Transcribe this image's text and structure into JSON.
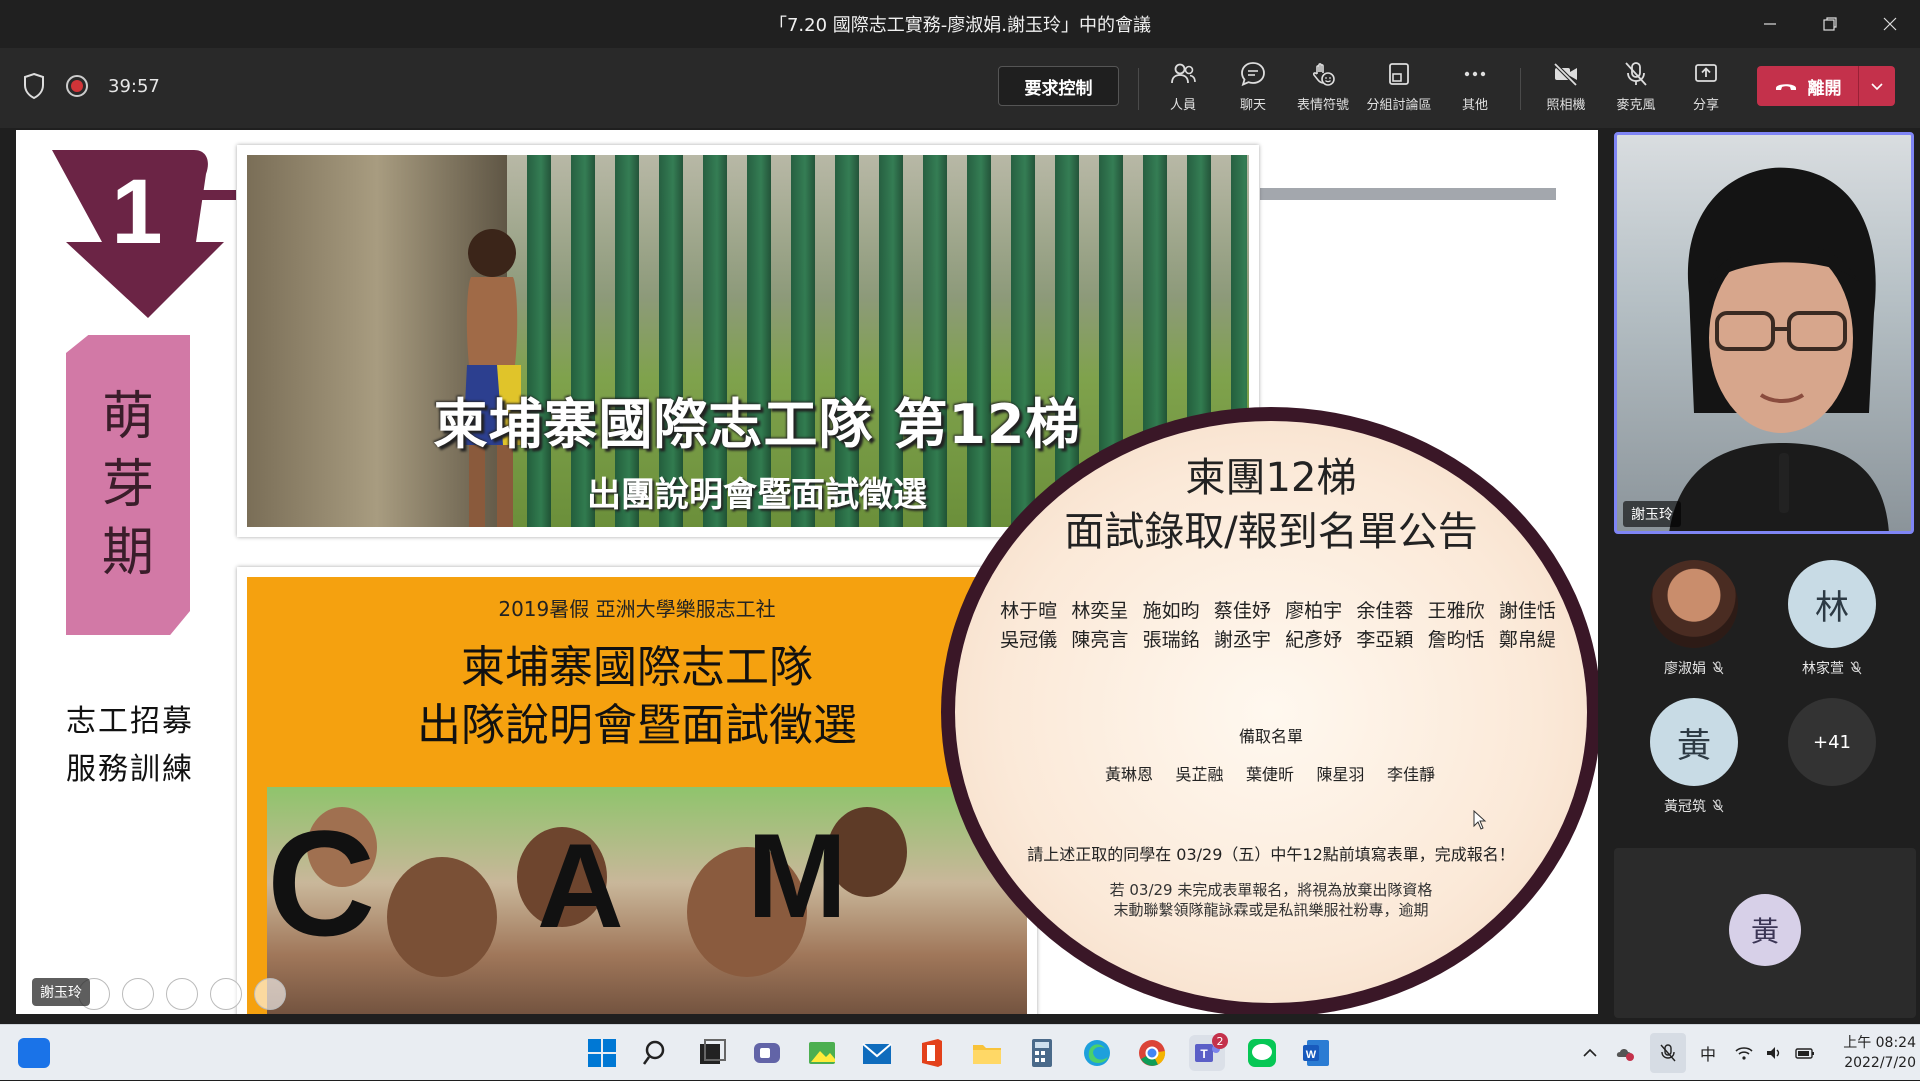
{
  "window": {
    "title": "「7.20 國際志工實務-廖淑娟.謝玉玲」中的會議"
  },
  "meeting": {
    "timer": "39:57",
    "request_control": "要求控制",
    "tools": [
      {
        "id": "people",
        "label": "人員",
        "icon": "people-icon"
      },
      {
        "id": "chat",
        "label": "聊天",
        "icon": "chat-icon"
      },
      {
        "id": "reactions",
        "label": "表情符號",
        "icon": "reactions-icon"
      },
      {
        "id": "breakout",
        "label": "分組討論區",
        "icon": "breakout-rooms-icon"
      },
      {
        "id": "more",
        "label": "其他",
        "icon": "more-icon"
      },
      {
        "id": "camera",
        "label": "照相機",
        "icon": "camera-off-icon"
      },
      {
        "id": "mic",
        "label": "麥克風",
        "icon": "mic-off-icon"
      },
      {
        "id": "share",
        "label": "分享",
        "icon": "share-icon"
      }
    ],
    "leave": "離開",
    "leave_color": "#c4314b"
  },
  "slide": {
    "step_number": "1",
    "stage_chars": [
      "萌",
      "芽",
      "期"
    ],
    "left_lines": [
      "志工招募",
      "服務訓練"
    ],
    "photo1_title": "柬埔寨國際志工隊 第12梯",
    "photo1_subtitle": "出團說明會暨面試徵選",
    "poster_org": "2019暑假 亞洲大學樂服志工社",
    "poster_title_1": "柬埔寨國際志工隊",
    "poster_title_2": "出隊說明會暨面試徵選",
    "poster_letters": [
      "C",
      "A",
      "M"
    ],
    "announcement": {
      "title_1": "柬團12梯",
      "title_2": "面試錄取/報到名單公告",
      "accepted": [
        "林于暄",
        "林奕呈",
        "施如昀",
        "蔡佳妤",
        "廖柏宇",
        "余佳蓉",
        "王雅欣",
        "謝佳恬",
        "吳冠儀",
        "陳亮言",
        "張瑞銘",
        "謝丞宇",
        "紀彥妤",
        "李亞穎",
        "詹昀恬",
        "鄭帛緹"
      ],
      "alternate_label": "備取名單",
      "alternates": [
        "黃琳恩",
        "吳芷融",
        "葉倢昕",
        "陳星羽",
        "李佳靜"
      ],
      "notice_1": "請上述正取的同學在 03/29（五）中午12點前填寫表單，完成報名！",
      "notice_2": "若 03/29 未完成表單報名，將視為放棄出隊資格",
      "notice_3": "末動聯繫領隊龍詠霖或是私訊樂服社粉專，逾期"
    },
    "presenter_label": "謝玉玲"
  },
  "side": {
    "active_speaker": "謝玉玲",
    "active_border_color": "#7f85f5",
    "participants": [
      {
        "name": "廖淑娟",
        "avatar": "photo",
        "initial": "",
        "muted": true
      },
      {
        "name": "林家萱",
        "avatar": "initial",
        "initial": "林",
        "muted": true
      },
      {
        "name": "黃冠筑",
        "avatar": "initial",
        "initial": "黃",
        "muted": true
      },
      {
        "name": "",
        "avatar": "more",
        "initial": "+41",
        "muted": false
      }
    ],
    "bottom_tile_initial": "黃"
  },
  "taskbar": {
    "ime": "中",
    "time": "上午 08:24",
    "date": "2022/7/20",
    "teams_badge": "2"
  }
}
